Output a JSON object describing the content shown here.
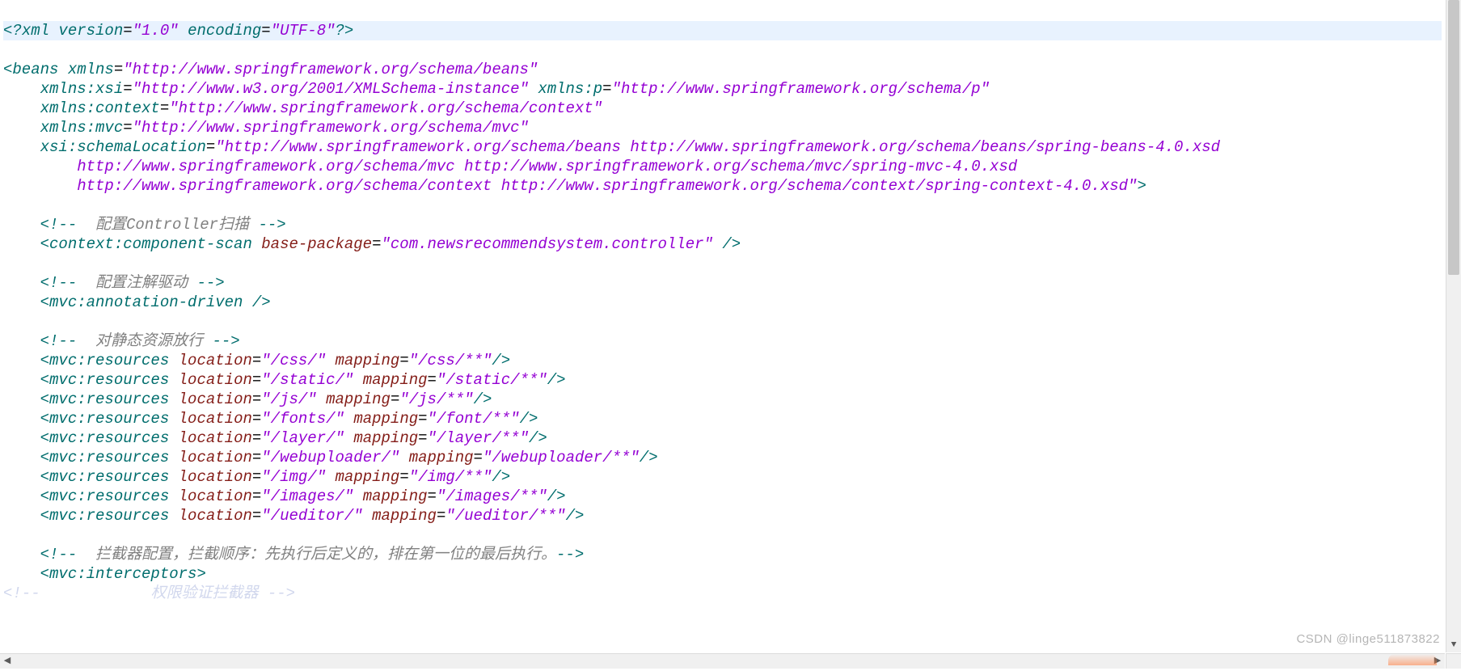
{
  "watermark": "CSDN @linge511873822",
  "indent": {
    "i1": "    ",
    "i2": "        ",
    "i3": "            "
  },
  "code": {
    "l1": {
      "a": "<?",
      "b": "xml ",
      "c": "version",
      "d": "=",
      "e": "\"1.0\"",
      "f": " ",
      "g": "encoding",
      "h": "=",
      "i": "\"UTF-8\"",
      "j": "?>"
    },
    "l2": {
      "a": "<",
      "b": "beans ",
      "c": "xmlns",
      "d": "=",
      "e": "\"http://www.springframework.org/schema/beans\""
    },
    "l3": {
      "a": "xmlns:xsi",
      "b": "=",
      "c": "\"http://www.w3.org/2001/XMLSchema-instance\"",
      "d": " ",
      "e": "xmlns:p",
      "f": "=",
      "g": "\"http://www.springframework.org/schema/p\""
    },
    "l4": {
      "a": "xmlns:context",
      "b": "=",
      "c": "\"http://www.springframework.org/schema/context\""
    },
    "l5": {
      "a": "xmlns:mvc",
      "b": "=",
      "c": "\"http://www.springframework.org/schema/mvc\""
    },
    "l6": {
      "a": "xsi:schemaLocation",
      "b": "=",
      "c": "\"http://www.springframework.org/schema/beans http://www.springframework.org/schema/beans/spring-beans-4.0.xsd"
    },
    "l7": {
      "a": "http://www.springframework.org/schema/mvc http://www.springframework.org/schema/mvc/spring-mvc-4.0.xsd"
    },
    "l8": {
      "a": "http://www.springframework.org/schema/context http://www.springframework.org/schema/context/spring-context-4.0.xsd\"",
      "b": ">"
    },
    "l10": {
      "a": "<!--",
      "b": "  配置Controller扫描 ",
      "c": "-->"
    },
    "l11": {
      "a": "<",
      "b": "context:component-scan ",
      "c": "base-package",
      "d": "=",
      "e": "\"com.newsrecommendsystem.controller\"",
      "f": " />"
    },
    "l13": {
      "a": "<!--",
      "b": "  配置注解驱动 ",
      "c": "-->"
    },
    "l14": {
      "a": "<",
      "b": "mvc:annotation-driven ",
      "c": "/>"
    },
    "l16": {
      "a": "<!--",
      "b": "  对静态资源放行 ",
      "c": "-->"
    },
    "l17": {
      "a": "<",
      "b": "mvc:resources ",
      "c": "location",
      "d": "=",
      "e": "\"/css/\"",
      "f": " ",
      "g": "mapping",
      "h": "=",
      "i": "\"/css/**\"",
      "j": "/>"
    },
    "l18": {
      "a": "<",
      "b": "mvc:resources ",
      "c": "location",
      "d": "=",
      "e": "\"/static/\"",
      "f": " ",
      "g": "mapping",
      "h": "=",
      "i": "\"/static/**\"",
      "j": "/>"
    },
    "l19": {
      "a": "<",
      "b": "mvc:resources ",
      "c": "location",
      "d": "=",
      "e": "\"/js/\"",
      "f": " ",
      "g": "mapping",
      "h": "=",
      "i": "\"/js/**\"",
      "j": "/>"
    },
    "l20": {
      "a": "<",
      "b": "mvc:resources ",
      "c": "location",
      "d": "=",
      "e": "\"/fonts/\"",
      "f": " ",
      "g": "mapping",
      "h": "=",
      "i": "\"/font/**\"",
      "j": "/>"
    },
    "l21": {
      "a": "<",
      "b": "mvc:resources ",
      "c": "location",
      "d": "=",
      "e": "\"/layer/\"",
      "f": " ",
      "g": "mapping",
      "h": "=",
      "i": "\"/layer/**\"",
      "j": "/>"
    },
    "l22": {
      "a": "<",
      "b": "mvc:resources ",
      "c": "location",
      "d": "=",
      "e": "\"/webuploader/\"",
      "f": " ",
      "g": "mapping",
      "h": "=",
      "i": "\"/webuploader/**\"",
      "j": "/>"
    },
    "l23": {
      "a": "<",
      "b": "mvc:resources ",
      "c": "location",
      "d": "=",
      "e": "\"/img/\"",
      "f": " ",
      "g": "mapping",
      "h": "=",
      "i": "\"/img/**\"",
      "j": "/>"
    },
    "l24": {
      "a": "<",
      "b": "mvc:resources ",
      "c": "location",
      "d": "=",
      "e": "\"/images/\"",
      "f": " ",
      "g": "mapping",
      "h": "=",
      "i": "\"/images/**\"",
      "j": "/>"
    },
    "l25": {
      "a": "<",
      "b": "mvc:resources ",
      "c": "location",
      "d": "=",
      "e": "\"/ueditor/\"",
      "f": " ",
      "g": "mapping",
      "h": "=",
      "i": "\"/ueditor/**\"",
      "j": "/>"
    },
    "l27": {
      "a": "<!--",
      "b": "  拦截器配置，拦截顺序：先执行后定义的，排在第一位的最后执行。",
      "c": "-->"
    },
    "l28": {
      "a": "<",
      "b": "mvc:interceptors",
      "c": ">"
    },
    "l29": {
      "a": "<!--",
      "b": "权限验证拦截器 ",
      "c": "-->"
    }
  }
}
